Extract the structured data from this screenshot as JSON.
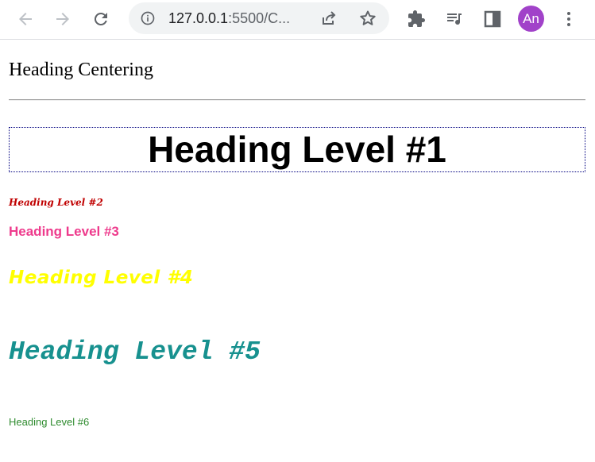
{
  "browser": {
    "url_host": "127.0.0.1",
    "url_rest": ":5500/C...",
    "avatar_initials": "An",
    "icons": [
      "back-icon",
      "forward-icon",
      "reload-icon",
      "info-icon",
      "share-icon",
      "bookmark-star-icon",
      "extensions-icon",
      "media-queue-icon",
      "side-panel-icon",
      "menu-icon"
    ]
  },
  "page": {
    "title": "Heading Centering",
    "h1": "Heading Level #1",
    "h2": "Heading Level #2",
    "h3": "Heading Level #3",
    "h4": "Heading Level #4",
    "h5": "Heading Level #5",
    "h6": "Heading Level #6"
  },
  "colors": {
    "h1": "#000000",
    "h1_border": "#000080",
    "h2": "#c00000",
    "h3": "#ee3a8c",
    "h4": "#ffff00",
    "h5": "#17918f",
    "h6": "#2e8b2e",
    "avatar": "#a142c9"
  }
}
